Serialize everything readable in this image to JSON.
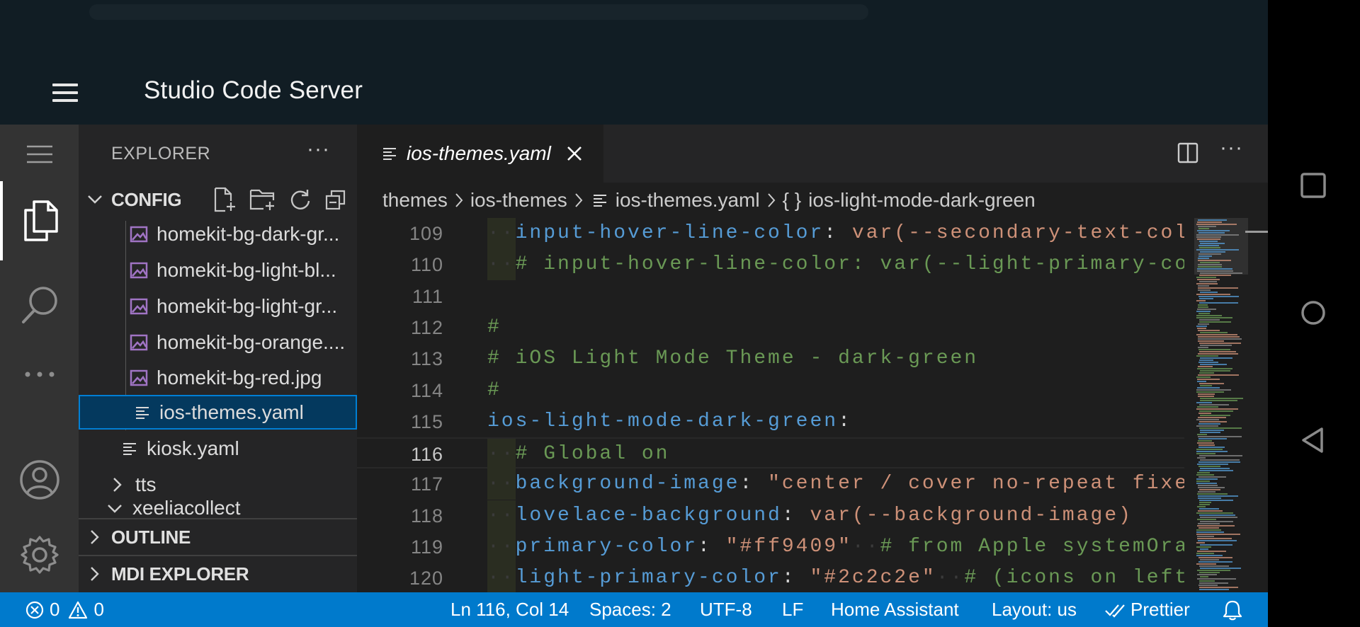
{
  "appbar": {
    "title": "Studio Code Server"
  },
  "sidebar": {
    "title": "EXPLORER",
    "more": "···",
    "config_label": "CONFIG",
    "files": [
      {
        "name": "homekit-bg-dark-gr...",
        "type": "image"
      },
      {
        "name": "homekit-bg-light-bl...",
        "type": "image"
      },
      {
        "name": "homekit-bg-light-gr...",
        "type": "image"
      },
      {
        "name": "homekit-bg-orange....",
        "type": "image"
      },
      {
        "name": "homekit-bg-red.jpg",
        "type": "image"
      },
      {
        "name": "ios-themes.yaml",
        "type": "yaml",
        "selected": true
      },
      {
        "name": "kiosk.yaml",
        "type": "yaml"
      },
      {
        "name": "tts",
        "type": "folder"
      },
      {
        "name": "xeeliacollect",
        "type": "folder"
      }
    ],
    "outline_label": "OUTLINE",
    "mdi_label": "MDI EXPLORER"
  },
  "editor": {
    "tab_name": "ios-themes.yaml",
    "more": "···",
    "breadcrumb": [
      "themes",
      "ios-themes",
      "ios-themes.yaml",
      "ios-light-mode-dark-green"
    ],
    "lines": [
      {
        "n": "109",
        "parts": [
          [
            "ws",
            "··"
          ],
          [
            "k",
            "input-hover-line-color"
          ],
          [
            "p",
            ": "
          ],
          [
            "s",
            "var(--secondary-text-colo"
          ]
        ]
      },
      {
        "n": "110",
        "parts": [
          [
            "ws",
            "··"
          ],
          [
            "c",
            "# input-hover-line-color: var(--light-primary-col"
          ]
        ]
      },
      {
        "n": "111",
        "parts": []
      },
      {
        "n": "112",
        "parts": [
          [
            "c",
            "#"
          ]
        ]
      },
      {
        "n": "113",
        "parts": [
          [
            "c",
            "# iOS Light Mode Theme - dark-green"
          ]
        ]
      },
      {
        "n": "114",
        "parts": [
          [
            "c",
            "#"
          ]
        ]
      },
      {
        "n": "115",
        "parts": [
          [
            "k",
            "ios-light-mode-dark-green"
          ],
          [
            "p",
            ":"
          ]
        ]
      },
      {
        "n": "116",
        "parts": [
          [
            "ws",
            "··"
          ],
          [
            "c",
            "# Global on"
          ]
        ],
        "current": true
      },
      {
        "n": "117",
        "parts": [
          [
            "ws",
            "··"
          ],
          [
            "k",
            "background-image"
          ],
          [
            "p",
            ": "
          ],
          [
            "s",
            "\"center / cover no-repeat fixed"
          ]
        ]
      },
      {
        "n": "118",
        "parts": [
          [
            "ws",
            "··"
          ],
          [
            "k",
            "lovelace-background"
          ],
          [
            "p",
            ": "
          ],
          [
            "s",
            "var(--background-image)"
          ]
        ]
      },
      {
        "n": "119",
        "parts": [
          [
            "ws",
            "··"
          ],
          [
            "k",
            "primary-color"
          ],
          [
            "p",
            ": "
          ],
          [
            "s",
            "\"#ff9409\""
          ],
          [
            "ws",
            "··"
          ],
          [
            "c",
            "# from Apple systemOran"
          ]
        ]
      },
      {
        "n": "120",
        "parts": [
          [
            "ws",
            "··"
          ],
          [
            "k",
            "light-primary-color"
          ],
          [
            "p",
            ": "
          ],
          [
            "s",
            "\"#2c2c2e\""
          ],
          [
            "ws",
            "··"
          ],
          [
            "c",
            "# (icons on left"
          ]
        ]
      }
    ]
  },
  "statusbar": {
    "errors": "0",
    "warnings": "0",
    "position": "Ln 116, Col 14",
    "spaces": "Spaces: 2",
    "encoding": "UTF-8",
    "eol": "LF",
    "language": "Home Assistant",
    "layout": "Layout: us",
    "prettier": "Prettier"
  },
  "colors": {
    "statusbar": "#007acc",
    "activity": "#333333",
    "sidebar": "#252526",
    "editor": "#1e1e1e",
    "appbar": "#111d24"
  }
}
